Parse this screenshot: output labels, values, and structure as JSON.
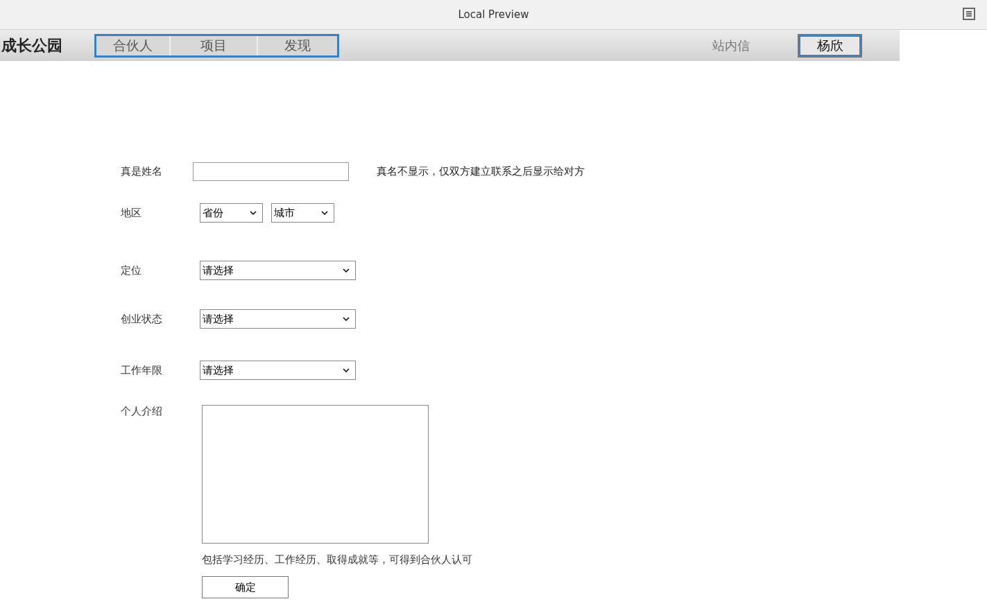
{
  "window": {
    "title": "Local Preview"
  },
  "nav": {
    "logo": "成长公园",
    "tabs": [
      {
        "label": "合伙人"
      },
      {
        "label": "项目"
      },
      {
        "label": "发现"
      }
    ],
    "messages_link": "站内信",
    "user_button": "杨欣"
  },
  "form": {
    "fields": [
      {
        "kind": "text",
        "label": "真是姓名",
        "note": "真名不显示，仅双方建立联系之后显示给对方"
      },
      {
        "kind": "select_pair",
        "label": "地区",
        "options": [
          "省份",
          "城市"
        ]
      },
      {
        "kind": "select",
        "label": "定位",
        "value": "请选择"
      },
      {
        "kind": "select",
        "label": "创业状态",
        "value": "请选择"
      },
      {
        "kind": "select",
        "label": "工作年限",
        "value": "请选择"
      },
      {
        "kind": "textarea",
        "label": "个人介绍",
        "hint": "包括学习经历、工作经历、取得成就等，可得到合伙人认可"
      }
    ],
    "submit": "确定"
  }
}
